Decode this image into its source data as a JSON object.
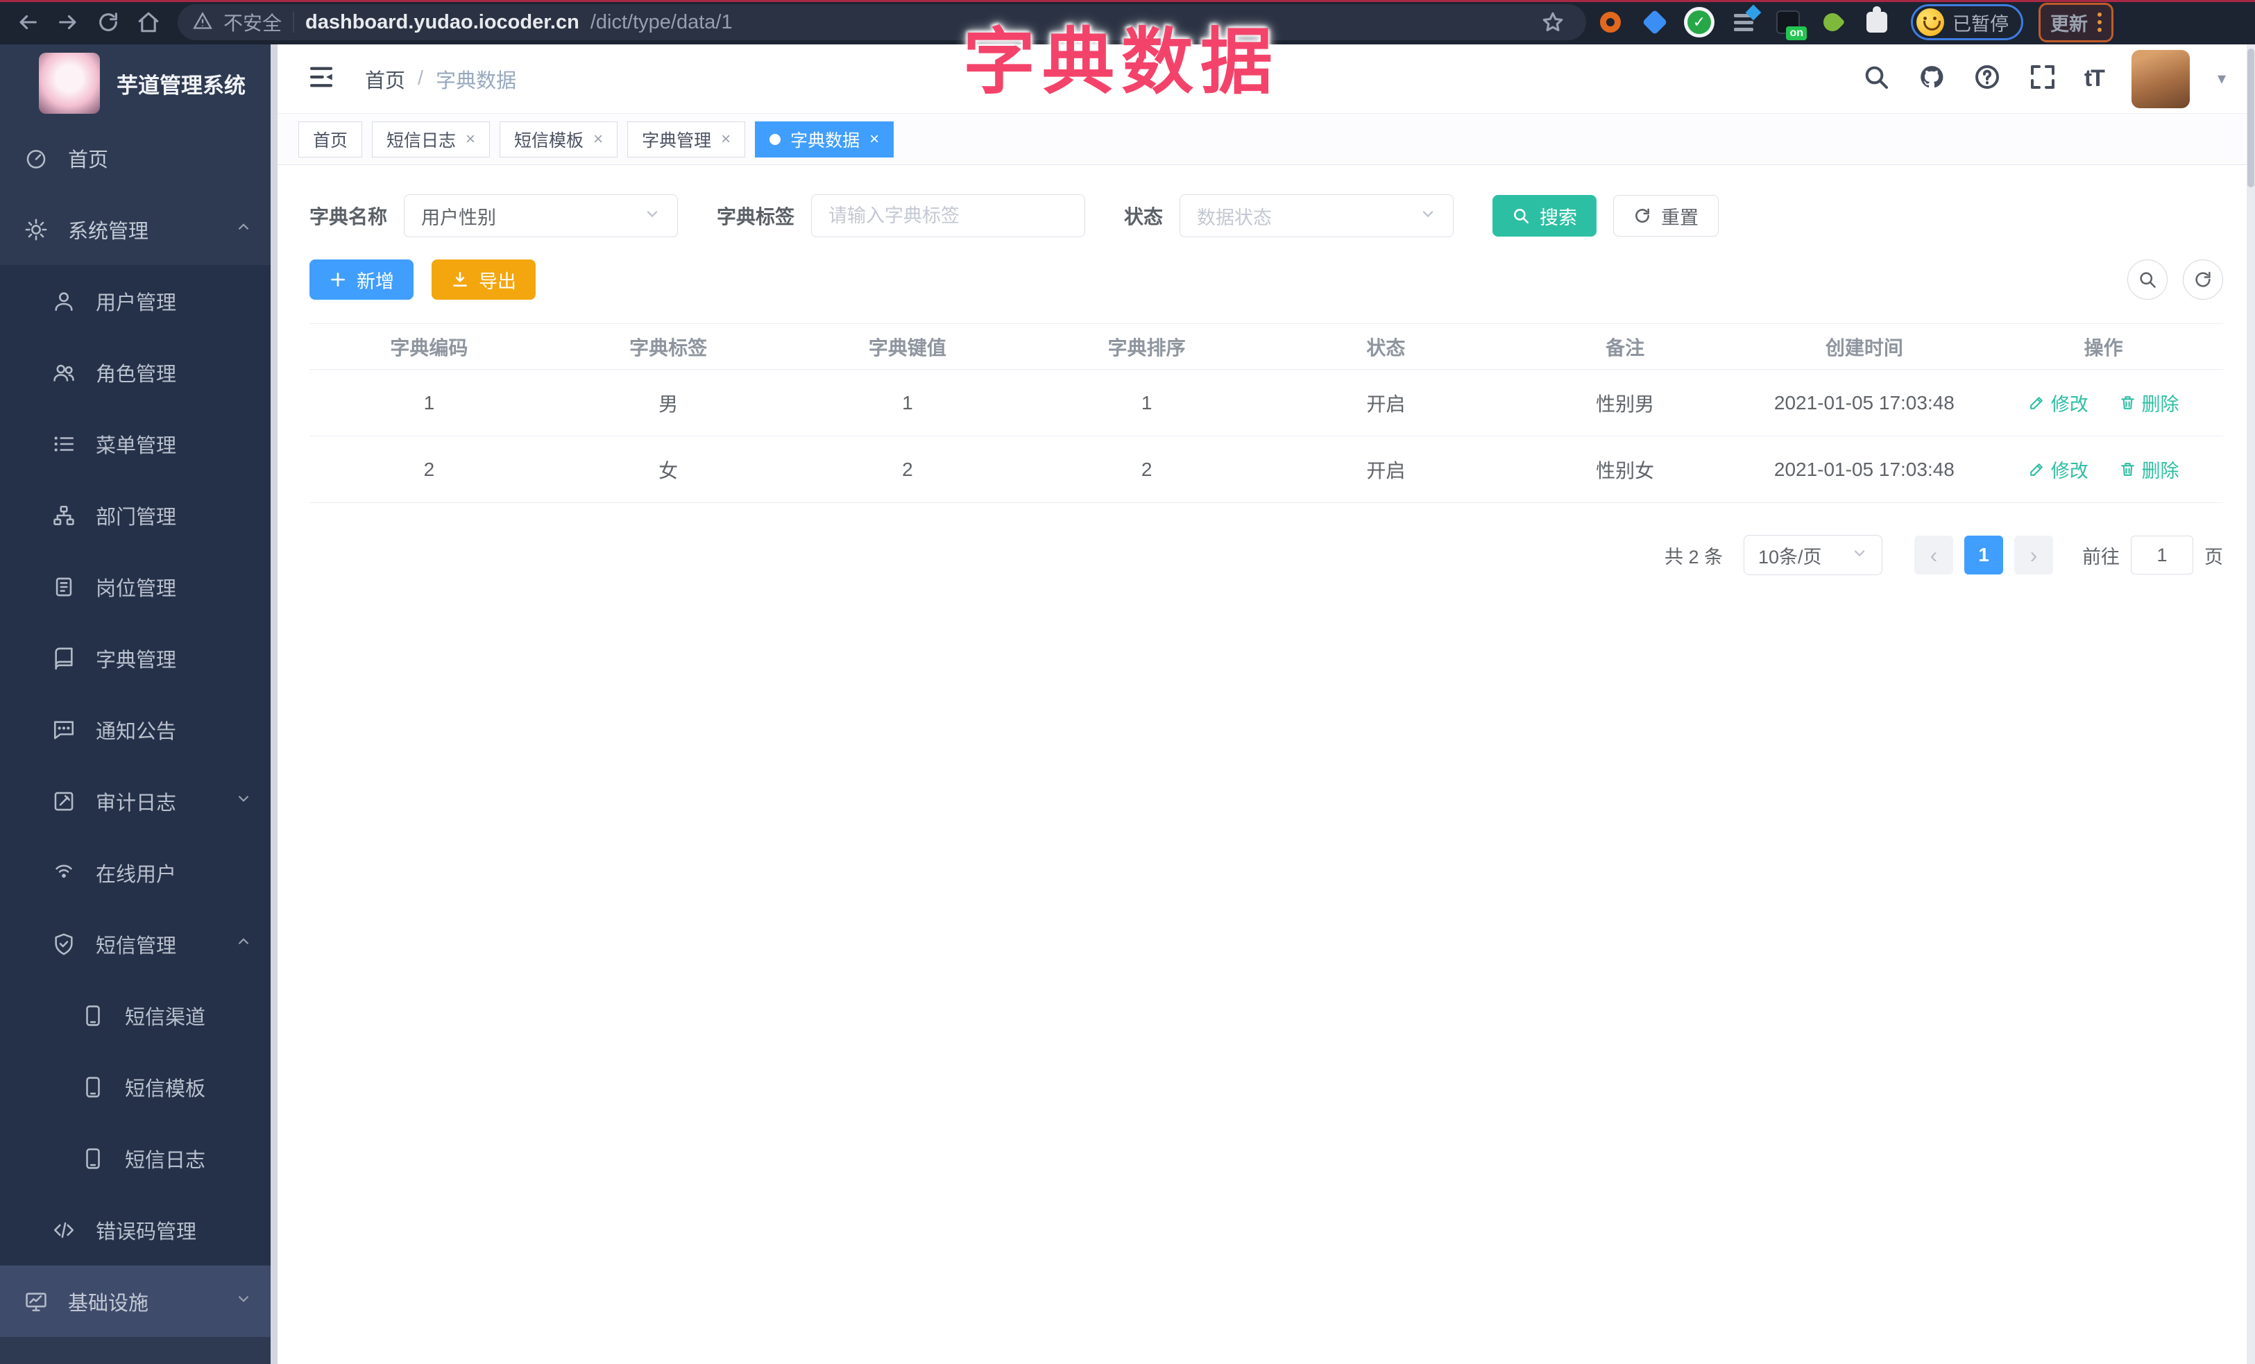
{
  "browser": {
    "security_text": "不安全",
    "url_domain": "dashboard.yudao.iocoder.cn",
    "url_path": "/dict/type/data/1",
    "extension_on_badge": "on",
    "profile_paused_label": "已暂停",
    "update_button_label": "更新"
  },
  "overlay": {
    "title": "字典数据"
  },
  "sidebar": {
    "logo_title": "芋道管理系统",
    "items": [
      {
        "label": "首页"
      },
      {
        "label": "系统管理"
      },
      {
        "label": "用户管理"
      },
      {
        "label": "角色管理"
      },
      {
        "label": "菜单管理"
      },
      {
        "label": "部门管理"
      },
      {
        "label": "岗位管理"
      },
      {
        "label": "字典管理"
      },
      {
        "label": "通知公告"
      },
      {
        "label": "审计日志"
      },
      {
        "label": "在线用户"
      },
      {
        "label": "短信管理"
      },
      {
        "label": "短信渠道"
      },
      {
        "label": "短信模板"
      },
      {
        "label": "短信日志"
      },
      {
        "label": "错误码管理"
      },
      {
        "label": "基础设施"
      }
    ]
  },
  "navbar": {
    "breadcrumb_home": "首页",
    "breadcrumb_separator": "/",
    "breadcrumb_current": "字典数据",
    "font_size_icon_text": "tT"
  },
  "tags": [
    {
      "label": "首页"
    },
    {
      "label": "短信日志"
    },
    {
      "label": "短信模板"
    },
    {
      "label": "字典管理"
    },
    {
      "label": "字典数据"
    }
  ],
  "filters": {
    "dict_name_label": "字典名称",
    "dict_name_value": "用户性别",
    "dict_label_label": "字典标签",
    "dict_label_placeholder": "请输入字典标签",
    "status_label": "状态",
    "status_placeholder": "数据状态",
    "search_button": "搜索",
    "reset_button": "重置"
  },
  "toolbar": {
    "add_button": "新增",
    "export_button": "导出"
  },
  "table": {
    "columns": [
      "字典编码",
      "字典标签",
      "字典键值",
      "字典排序",
      "状态",
      "备注",
      "创建时间",
      "操作"
    ],
    "rows": [
      {
        "code": "1",
        "label": "男",
        "value": "1",
        "sort": "1",
        "status": "开启",
        "remark": "性别男",
        "created": "2021-01-05 17:03:48",
        "edit": "修改",
        "delete": "删除"
      },
      {
        "code": "2",
        "label": "女",
        "value": "2",
        "sort": "2",
        "status": "开启",
        "remark": "性别女",
        "created": "2021-01-05 17:03:48",
        "edit": "修改",
        "delete": "删除"
      }
    ]
  },
  "pagination": {
    "total_text": "共 2 条",
    "page_size_text": "10条/页",
    "current_page": "1",
    "goto_label": "前往",
    "goto_value": "1",
    "page_unit": "页"
  },
  "colors": {
    "primary": "#409eff",
    "teal": "#2dbfa3",
    "warning": "#f3a60d",
    "overlay_pink": "#f4436a"
  }
}
